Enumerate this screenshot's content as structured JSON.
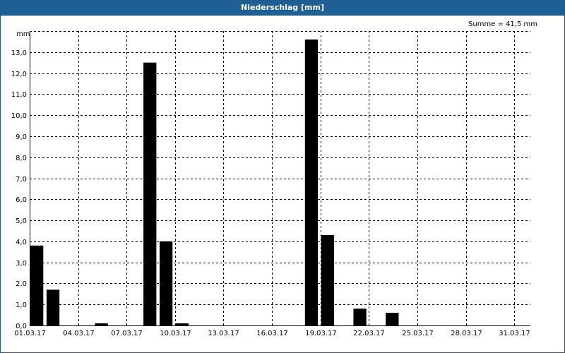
{
  "window": {
    "title": "Niederschlag [mm]"
  },
  "summary": {
    "text": "Summe = 41,5 mm"
  },
  "colors": {
    "titlebar": "#1e5f94",
    "bar": "#000000",
    "grid": "#000000",
    "axis": "#000000"
  },
  "chart_data": {
    "type": "bar",
    "title": "Niederschlag [mm]",
    "ylabel": "mm",
    "xlabel": "",
    "ylim": [
      0,
      14
    ],
    "grid": true,
    "y_ticks": [
      "0,0",
      "1,0",
      "2,0",
      "3,0",
      "4,0",
      "5,0",
      "6,0",
      "7,0",
      "8,0",
      "9,0",
      "10,0",
      "11,0",
      "12,0",
      "13,0"
    ],
    "x_tick_labels": [
      "01.03.17",
      "04.03.17",
      "07.03.17",
      "10.03.17",
      "13.03.17",
      "16.03.17",
      "19.03.17",
      "22.03.17",
      "25.03.17",
      "28.03.17",
      "31.03.17"
    ],
    "categories": [
      "01.03.17",
      "02.03.17",
      "03.03.17",
      "04.03.17",
      "05.03.17",
      "06.03.17",
      "07.03.17",
      "08.03.17",
      "09.03.17",
      "10.03.17",
      "11.03.17",
      "12.03.17",
      "13.03.17",
      "14.03.17",
      "15.03.17",
      "16.03.17",
      "17.03.17",
      "18.03.17",
      "19.03.17",
      "20.03.17",
      "21.03.17",
      "22.03.17",
      "23.03.17",
      "24.03.17",
      "25.03.17",
      "26.03.17",
      "27.03.17",
      "28.03.17",
      "29.03.17",
      "30.03.17",
      "31.03.17"
    ],
    "values": [
      3.8,
      1.7,
      0,
      0,
      0.1,
      0,
      0,
      12.5,
      4.0,
      0.1,
      0,
      0,
      0,
      0,
      0,
      0,
      0,
      13.6,
      4.3,
      0,
      0.8,
      0,
      0.6,
      0,
      0,
      0,
      0,
      0,
      0,
      0,
      0
    ]
  }
}
